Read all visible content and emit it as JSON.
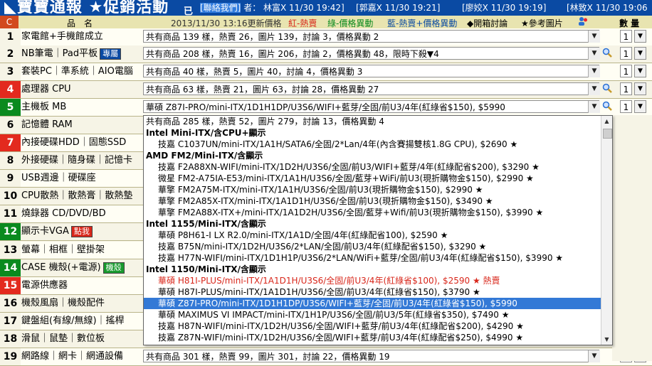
{
  "banner": {
    "title": "◣寶寶通報 ★促銷活動",
    "bracket": "已",
    "messages": [
      {
        "text_a": "[聯絡我們]",
        "text_b": " 者： 林富X 11/30 19:42]"
      },
      {
        "text_a": "[郭嘉X 11/30 19:21]",
        "text_b": ""
      },
      {
        "text_a": "[廖姣X 11/30 19:19]",
        "text_b": ""
      },
      {
        "text_a": "[林致X 11/30 19:06",
        "text_b": ""
      }
    ]
  },
  "header": {
    "c_label": "C",
    "item_label": "品　名",
    "updated": "2013/11/30 13:16更新價格",
    "legend_red": "紅-熱賣",
    "legend_green": "綠-價格異動",
    "legend_blue": "藍-熱賣+價格異動",
    "legend_open": "◆開箱討論",
    "legend_ref": "★參考圖片",
    "qty_label": "數 量"
  },
  "rows": [
    {
      "num": "1",
      "label": "家電館+手機館成立",
      "badge": "",
      "summary": "共有商品 139 樣，熱賣 26，圖片 139，討論 3，價格異動 2",
      "qty": "1",
      "color": ""
    },
    {
      "num": "2",
      "label": "NB筆電｜Pad平板",
      "badge": "專屬",
      "summary": "共有商品 208 樣，熱賣 16，圖片 206，討論 2，價格異動 48，限時下殺▼4",
      "qty": "1",
      "color": ""
    },
    {
      "num": "3",
      "label": "套裝PC｜準系統｜AIO電腦",
      "badge": "",
      "summary": "共有商品 40 樣，熱賣 5，圖片 40，討論 4，價格異動 3",
      "qty": "1",
      "color": ""
    },
    {
      "num": "4",
      "label": "處理器 CPU",
      "badge": "",
      "summary": "共有商品 63 樣，熱賣 21，圖片 63，討論 28，價格異動 27",
      "qty": "1",
      "color": "red"
    },
    {
      "num": "5",
      "label": "主機板 MB",
      "badge": "",
      "summary": "華碩 Z87I-PRO/mini-ITX/1D1H1DP/U3S6/WIFI+藍芽/全固/前U3/4年(紅綠省$150), $5990",
      "qty": "1",
      "color": "green"
    },
    {
      "num": "6",
      "label": "記憶體 RAM",
      "badge": "",
      "summary": "",
      "qty": "",
      "color": ""
    },
    {
      "num": "7",
      "label": "內接硬碟HDD｜固態SSD",
      "badge": "",
      "summary": "",
      "qty": "",
      "color": "red"
    },
    {
      "num": "8",
      "label": "外接硬碟｜隨身碟｜記憶卡",
      "badge": "",
      "summary": "",
      "qty": "",
      "color": ""
    },
    {
      "num": "9",
      "label": "USB週邊｜硬碟座",
      "badge": "",
      "summary": "",
      "qty": "",
      "color": ""
    },
    {
      "num": "10",
      "label": "CPU散熱｜散熱膏｜散熱墊",
      "badge": "",
      "summary": "",
      "qty": "",
      "color": ""
    },
    {
      "num": "11",
      "label": "燒錄器 CD/DVD/BD",
      "badge": "",
      "summary": "",
      "qty": "",
      "color": ""
    },
    {
      "num": "12",
      "label": "顯示卡VGA",
      "badge": "點我",
      "summary": "",
      "qty": "",
      "color": "green"
    },
    {
      "num": "13",
      "label": "螢幕｜相框｜壁掛架",
      "badge": "",
      "summary": "",
      "qty": "",
      "color": ""
    },
    {
      "num": "14",
      "label": "CASE 機殼(+電源)",
      "badge": "機殼",
      "summary": "",
      "qty": "",
      "color": "green"
    },
    {
      "num": "15",
      "label": "電源供應器",
      "badge": "",
      "summary": "",
      "qty": "",
      "color": "red"
    },
    {
      "num": "16",
      "label": "機殼風扇｜機殼配件",
      "badge": "",
      "summary": "",
      "qty": "",
      "color": ""
    },
    {
      "num": "17",
      "label": "鍵盤組(有線/無線)｜搖桿",
      "badge": "",
      "summary": "",
      "qty": "",
      "color": ""
    },
    {
      "num": "18",
      "label": "滑鼠｜鼠墊｜數位板",
      "badge": "",
      "summary": "",
      "qty": "",
      "color": ""
    },
    {
      "num": "19",
      "label": "網路線｜網卡｜網通設備",
      "badge": "",
      "summary": "共有商品 301 樣，熱賣 99，圖片 301，討論 22，價格異動 19",
      "qty": "1",
      "color": ""
    }
  ],
  "dropdown": {
    "summary": "共有商品 285 樣，熱賣 52，圖片 279，討論 13，價格異動 4",
    "groups": [
      {
        "title": "Intel Mini-ITX/含CPU+顯示",
        "items": [
          {
            "text": "技嘉 C1037UN/mini-ITX/1A1H/SATA6/全固/2*Lan/4年(內含賽揚雙核1.8G CPU), $2690 ★",
            "style": ""
          }
        ]
      },
      {
        "title": "AMD FM2/Mini-ITX/含顯示",
        "items": [
          {
            "text": "技嘉 F2A88XN-WIFI/mini-ITX/1D2H/U3S6/全固/前U3/WIFI+藍芽/4年(紅綠配省$200), $3290 ★",
            "style": ""
          },
          {
            "text": "微星 FM2-A75IA-E53/mini-ITX/1A1H/U3S6/全固/藍芽+WiFi/前U3(現折購物金$150), $2990 ★",
            "style": ""
          },
          {
            "text": "華擎 FM2A75M-ITX/mini-ITX/1A1H/U3S6/全固/前U3(現折購物金$150), $2990 ★",
            "style": ""
          },
          {
            "text": "華擎 FM2A85X-ITX/mini-ITX/1A1D1H/U3S6/全固/前U3(現折購物金$150), $3490 ★",
            "style": ""
          },
          {
            "text": "華擎 FM2A88X-ITX+/mini-ITX/1A1D2H/U3S6/全固/藍芽+Wifi/前U3(現折購物金$150), $3990 ★",
            "style": ""
          }
        ]
      },
      {
        "title": "Intel 1155/Mini-ITX/含顯示",
        "items": [
          {
            "text": "華碩 P8H61-I LX R2.0/mini-ITX/1A1D/全固/4年(紅綠配省100), $2590 ★",
            "style": ""
          },
          {
            "text": "技嘉 B75N/mini-ITX/1D2H/U3S6/2*LAN/全固/前U3/4年(紅綠配省$150), $3290 ★",
            "style": ""
          },
          {
            "text": "技嘉 H77N-WIFI/mini-ITX/1D1H1P/U3S6/2*LAN/WiFi+藍芽/全固/前U3/4年(紅綠配省$150), $3990 ★",
            "style": ""
          }
        ]
      },
      {
        "title": "Intel 1150/Mini-ITX/含顯示",
        "items": [
          {
            "text": "華碩 H81I-PLUS/mini-ITX/1A1D1H/U3S6/全固/前U3/4年(紅綠省$100), $2590 ★ 熱賣",
            "style": "red"
          },
          {
            "text": "華碩 H87I-PLUS/mini-ITX/1A1D1H/U3S6/全固/前U3/4年(紅綠省$150), $3790 ★",
            "style": ""
          },
          {
            "text": "華碩 Z87I-PRO/mini-ITX/1D1H1DP/U3S6/WIFI+藍芽/全固/前U3/4年(紅綠省$150), $5990",
            "style": "selected"
          },
          {
            "text": "華碩 MAXIMUS VI IMPACT/mini-ITX/1H1P/U3S6/全固/前U3/5年(紅綠省$350), $7490 ★",
            "style": ""
          },
          {
            "text": "技嘉 H87N-WIFI/mini-ITX/1D2H/U3S6/全固/WIFI+藍芽/前U3/4年(紅綠配省$200), $4290 ★",
            "style": ""
          },
          {
            "text": "技嘉 Z87N-WIFI/mini-ITX/1D2H/U3S6/全固/WIFI+藍芽/前U3/4年(紅綠配省$250), $4990 ★",
            "style": ""
          }
        ]
      }
    ]
  },
  "icons": {
    "dropdown": "chevron-down-icon",
    "magnifier": "magnifier-icon",
    "scroll_up": "scroll-up-icon",
    "scroll_down": "scroll-down-icon"
  },
  "colors": {
    "banner": "#0a4aa3",
    "row_red": "#e32a1e",
    "row_green": "#0a8a1e",
    "selected": "#3379d6",
    "hot": "#d8261a"
  }
}
